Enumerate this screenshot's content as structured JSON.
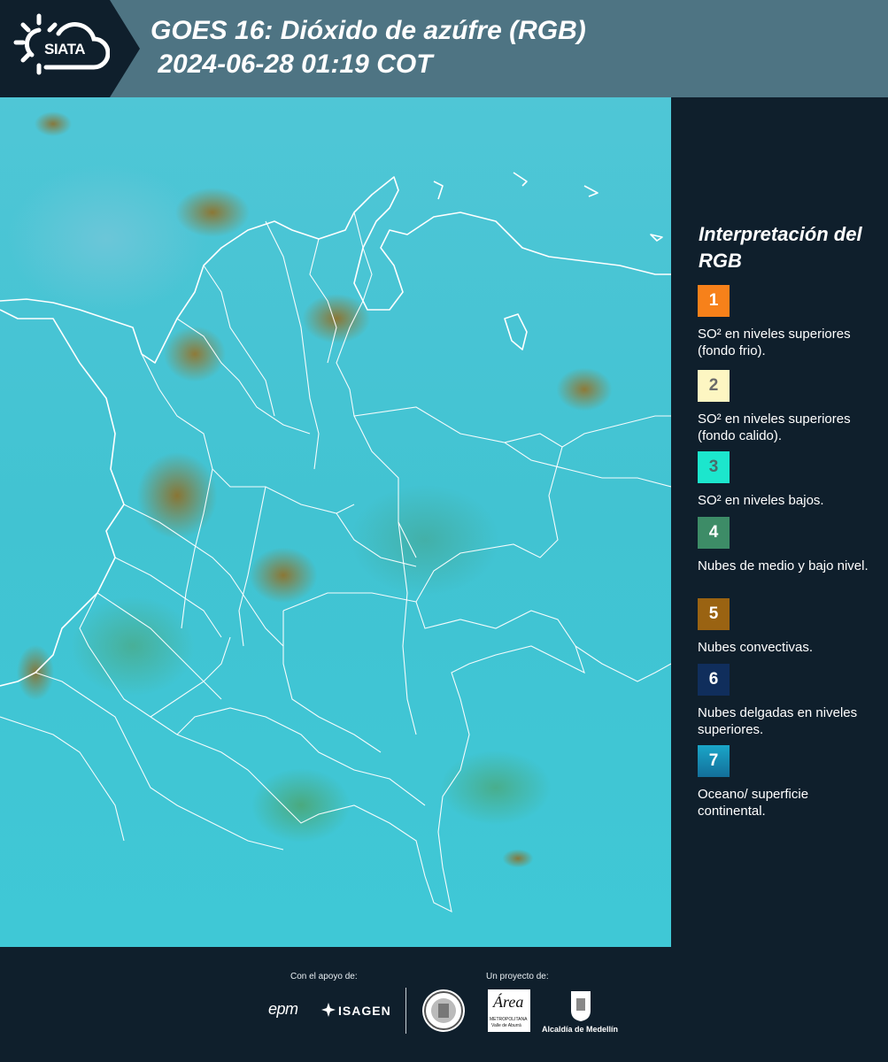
{
  "header": {
    "logo_text": "SIATA",
    "title_line1": "GOES 16: Dióxido de azúfre (RGB)",
    "title_line2": " 2024-06-28 01:19 COT"
  },
  "map": {
    "icon": "satellite-map-image"
  },
  "legend": {
    "title": "Interpretación del RGB",
    "items": [
      {
        "number": "1",
        "color": "#f7811a",
        "text": "SO² en niveles superiores (fondo frio)."
      },
      {
        "number": "2",
        "color": "#fdf6c2",
        "text": "SO² en niveles superiores (fondo calido)."
      },
      {
        "number": "3",
        "color": "#1ce6cd",
        "text": "SO² en niveles bajos."
      },
      {
        "number": "4",
        "color": "#3d8c67",
        "text": "Nubes de medio y bajo nivel."
      },
      {
        "number": "5",
        "color": "#9a6312",
        "text": "Nubes convectivas."
      },
      {
        "number": "6",
        "color": "#102e5c",
        "text": "Nubes delgadas en niveles superiores."
      },
      {
        "number": "7",
        "color": "#1891bf",
        "text": "Oceano/ superficie continental."
      }
    ]
  },
  "footer": {
    "support_label": "Con el apoyo de:",
    "project_label": "Un proyecto de:",
    "epm": "epm",
    "isagen": "ISAGEN",
    "area_name": "Área",
    "area_sub1": "METROPOLITANA",
    "area_sub2": "Valle de Aburrá",
    "alcaldia": "Alcaldía de Medellín"
  }
}
